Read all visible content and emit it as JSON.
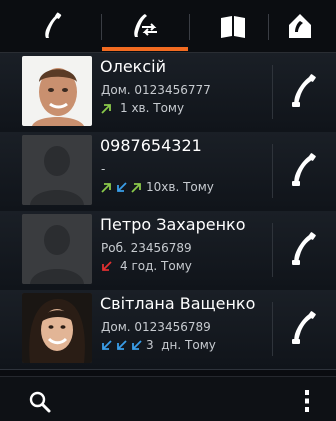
{
  "tabs": [
    {
      "name": "tab-dialer",
      "icon": "phone-icon"
    },
    {
      "name": "tab-call-log",
      "icon": "call-log-icon",
      "selected": true
    },
    {
      "name": "tab-contacts",
      "icon": "contacts-book-icon"
    },
    {
      "name": "tab-favorites",
      "icon": "home-icon"
    }
  ],
  "accent_color": "#f26b21",
  "calls": [
    {
      "name": "Олексій",
      "detail": "Дом. 0123456777",
      "time": "1 хв. Тому",
      "call_types": [
        "outgoing"
      ],
      "avatar": "photo-man"
    },
    {
      "name": "0987654321",
      "detail": "-",
      "time": "10хв. Тому",
      "call_types": [
        "outgoing",
        "incoming",
        "outgoing"
      ],
      "avatar": "placeholder"
    },
    {
      "name": "Петро Захаренко",
      "detail": "Роб. 23456789",
      "time": "4 год. Тому",
      "call_types": [
        "missed"
      ],
      "avatar": "placeholder"
    },
    {
      "name": "Світлана Ващенко",
      "detail": "Дом. 0123456789",
      "time": "3  дн. Тому",
      "call_types": [
        "incoming",
        "incoming",
        "incoming"
      ],
      "avatar": "photo-woman"
    }
  ],
  "bottom": {
    "left_icon": "search-icon",
    "right_icon": "overflow-menu-icon"
  }
}
